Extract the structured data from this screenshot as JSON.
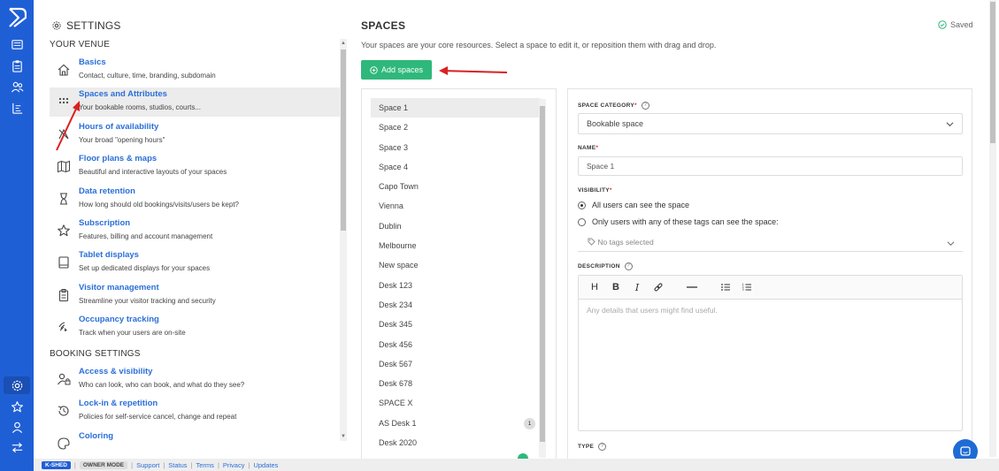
{
  "settings": {
    "title": "SETTINGS",
    "venue_header": "YOUR VENUE",
    "booking_header": "BOOKING SETTINGS",
    "venue_items": [
      {
        "title": "Basics",
        "desc": "Contact, culture, time, branding, subdomain",
        "icon": "home-icon"
      },
      {
        "title": "Spaces and Attributes",
        "desc": "Your bookable rooms, studios, courts...",
        "icon": "grid-icon"
      },
      {
        "title": "Hours of availability",
        "desc": "Your broad \"opening hours\"",
        "icon": "clock-icon"
      },
      {
        "title": "Floor plans & maps",
        "desc": "Beautiful and interactive layouts of your spaces",
        "icon": "map-icon"
      },
      {
        "title": "Data retention",
        "desc": "How long should old bookings/visits/users be kept?",
        "icon": "hourglass-icon"
      },
      {
        "title": "Subscription",
        "desc": "Features, billing and account management",
        "icon": "star-icon"
      },
      {
        "title": "Tablet displays",
        "desc": "Set up dedicated displays for your spaces",
        "icon": "tablet-icon"
      },
      {
        "title": "Visitor management",
        "desc": "Streamline your visitor tracking and security",
        "icon": "clipboard-icon"
      },
      {
        "title": "Occupancy tracking",
        "desc": "Track when your users are on-site",
        "icon": "signal-icon"
      }
    ],
    "booking_items": [
      {
        "title": "Access & visibility",
        "desc": "Who can look, who can book, and what do they see?",
        "icon": "user-lock-icon"
      },
      {
        "title": "Lock-in & repetition",
        "desc": "Policies for self-service cancel, change and repeat",
        "icon": "history-icon"
      },
      {
        "title": "Coloring",
        "desc": "",
        "icon": "palette-icon"
      }
    ]
  },
  "spaces": {
    "title": "SPACES",
    "subtitle": "Your spaces are your core resources. Select a space to edit it, or reposition them with drag and drop.",
    "saved_label": "Saved",
    "add_label": "Add spaces",
    "list": [
      {
        "name": "Space 1",
        "badge": ""
      },
      {
        "name": "Space 2",
        "badge": ""
      },
      {
        "name": "Space 3",
        "badge": ""
      },
      {
        "name": "Space 4",
        "badge": ""
      },
      {
        "name": "Capo Town",
        "badge": ""
      },
      {
        "name": "Vienna",
        "badge": ""
      },
      {
        "name": "Dublin",
        "badge": ""
      },
      {
        "name": "Melbourne",
        "badge": ""
      },
      {
        "name": "New space",
        "badge": ""
      },
      {
        "name": "Desk 123",
        "badge": ""
      },
      {
        "name": "Desk 234",
        "badge": ""
      },
      {
        "name": "Desk 345",
        "badge": ""
      },
      {
        "name": "Desk 456",
        "badge": ""
      },
      {
        "name": "Desk 567",
        "badge": ""
      },
      {
        "name": "Desk 678",
        "badge": ""
      },
      {
        "name": "SPACE X",
        "badge": ""
      },
      {
        "name": "AS Desk 1",
        "badge": "1"
      },
      {
        "name": "Desk 2020",
        "badge": ""
      }
    ]
  },
  "form": {
    "category_label": "SPACE CATEGORY",
    "category_value": "Bookable space",
    "name_label": "NAME",
    "name_value": "Space 1",
    "visibility_label": "VISIBILITY",
    "visibility_all": "All users can see the space",
    "visibility_tags": "Only users with any of these tags can see the space:",
    "tags_placeholder": "No tags selected",
    "description_label": "DESCRIPTION",
    "description_placeholder": "Any details that users might find useful.",
    "type_label": "TYPE",
    "toolbar": {
      "h": "H",
      "b": "B",
      "i": "I"
    }
  },
  "footer": {
    "brand": "K-SHED",
    "mode": "OWNER MODE",
    "links": [
      "Support",
      "Status",
      "Terms",
      "Privacy",
      "Updates"
    ]
  },
  "colors": {
    "rail": "#1f5fd6",
    "accent": "#2a6fd8",
    "add_button": "#2fb87b",
    "annotation": "#d92121"
  }
}
